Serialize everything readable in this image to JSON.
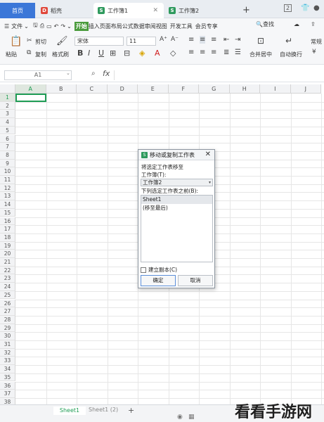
{
  "tabs": [
    {
      "label": "首页",
      "active": false
    },
    {
      "label": "稻壳",
      "active": false
    },
    {
      "label": "工作簿1",
      "active": true
    },
    {
      "label": "工作簿2",
      "active": false
    }
  ],
  "tab_right": {
    "badge": "2"
  },
  "menu": {
    "file": "文件",
    "start": "开始",
    "items_text": "插入页面布局公式数据审阅视图",
    "devtools": "开发工具",
    "member": "会员专享",
    "search": "查找"
  },
  "ribbon": {
    "paste": "粘贴",
    "cut": "剪切",
    "copy": "复制",
    "format_painter": "格式刷",
    "font": "宋体",
    "font_size": "11",
    "bold": "B",
    "italic": "I",
    "underline": "U",
    "merge": "合并居中",
    "wrap": "自动换行",
    "normal": "常规"
  },
  "formula_bar": {
    "cell_ref": "A1",
    "fx": "fx"
  },
  "columns": [
    "A",
    "B",
    "C",
    "D",
    "E",
    "F",
    "G",
    "H",
    "I",
    "J"
  ],
  "rows": [
    "1",
    "2",
    "3",
    "4",
    "5",
    "6",
    "7",
    "8",
    "9",
    "10",
    "11",
    "12",
    "13",
    "14",
    "15",
    "16",
    "17",
    "18",
    "19",
    "20",
    "21",
    "22",
    "23",
    "24",
    "25",
    "26",
    "27",
    "28",
    "29",
    "30",
    "31",
    "32",
    "33",
    "34",
    "35",
    "36",
    "37",
    "38"
  ],
  "dialog": {
    "title": "移动或复制工作表",
    "move_label": "将选定工作表移至",
    "workbook_label": "工作簿(T):",
    "workbook_value": "工作簿2",
    "before_label": "下列选定工作表之前(B):",
    "list_items": [
      "Sheet1",
      "(移至最后)"
    ],
    "copy_checkbox": "建立副本(C)",
    "ok": "确定",
    "cancel": "取消"
  },
  "sheets": [
    "Sheet1",
    "Sheet1 (2)"
  ],
  "watermark": "看看手游网"
}
